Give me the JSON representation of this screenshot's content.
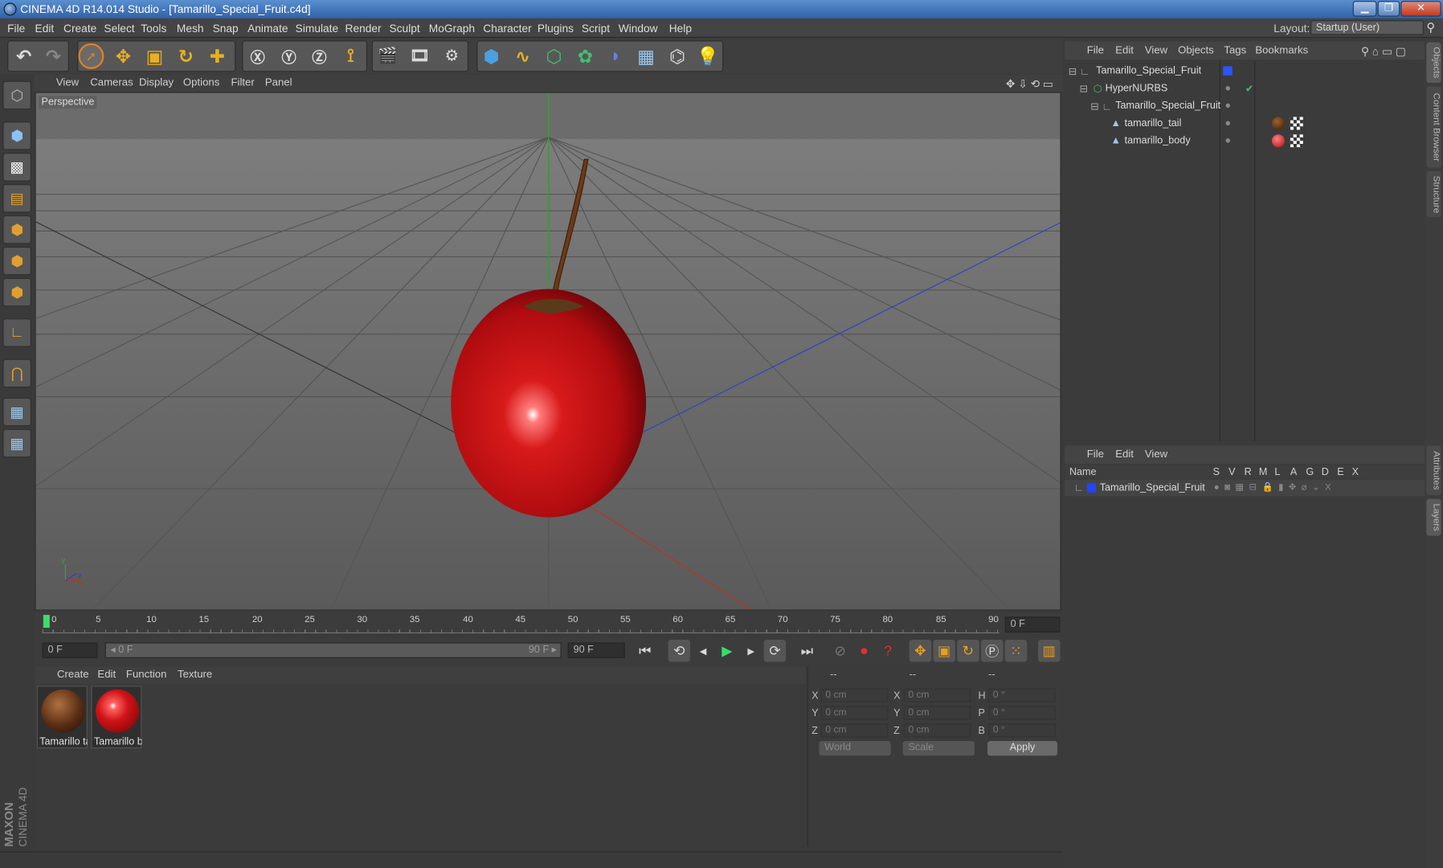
{
  "window": {
    "title": "CINEMA 4D R14.014 Studio - [Tamarillo_Special_Fruit.c4d]",
    "minimize": "▁",
    "restore": "❐",
    "close": "✕"
  },
  "menubar": [
    "File",
    "Edit",
    "Create",
    "Select",
    "Tools",
    "Mesh",
    "Snap",
    "Animate",
    "Simulate",
    "Render",
    "Sculpt",
    "MoGraph",
    "Character",
    "Plugins",
    "Script",
    "Window",
    "Help"
  ],
  "layout": {
    "label": "Layout:",
    "value": "Startup (User)"
  },
  "viewport": {
    "menu": [
      "View",
      "Cameras",
      "Display",
      "Options",
      "Filter",
      "Panel"
    ],
    "label": "Perspective"
  },
  "timeline": {
    "ticks": [
      "0",
      "5",
      "10",
      "15",
      "20",
      "25",
      "30",
      "35",
      "40",
      "45",
      "50",
      "55",
      "60",
      "65",
      "70",
      "75",
      "80",
      "85",
      "90"
    ],
    "current_frame": "0 F",
    "start_field": "0 F",
    "range_start": "◂ 0 F",
    "range_end": "90 F ▸",
    "end_field": "90 F"
  },
  "materials": {
    "menu": [
      "Create",
      "Edit",
      "Function",
      "Texture"
    ],
    "items": [
      {
        "name": "Tamarillo_tail",
        "label": "Tamarillo ta",
        "color": "#5a2e14"
      },
      {
        "name": "Tamarillo_body",
        "label": "Tamarillo b",
        "color": "#c4121a"
      }
    ]
  },
  "coordinates": {
    "header": [
      "--",
      "--",
      "--"
    ],
    "rows": [
      {
        "a": "X",
        "av": "0 cm",
        "b": "X",
        "bv": "0 cm",
        "c": "H",
        "cv": "0 °"
      },
      {
        "a": "Y",
        "av": "0 cm",
        "b": "Y",
        "bv": "0 cm",
        "c": "P",
        "cv": "0 °"
      },
      {
        "a": "Z",
        "av": "0 cm",
        "b": "Z",
        "bv": "0 cm",
        "c": "B",
        "cv": "0 °"
      }
    ],
    "mode": "World",
    "scale": "Scale",
    "apply": "Apply"
  },
  "objects": {
    "menu": [
      "File",
      "Edit",
      "View",
      "Objects",
      "Tags",
      "Bookmarks"
    ],
    "tree": [
      {
        "name": "Tamarillo_Special_Fruit"
      },
      {
        "name": "HyperNURBS"
      },
      {
        "name": "Tamarillo_Special_Fruit"
      },
      {
        "name": "tamarillo_tail"
      },
      {
        "name": "tamarillo_body"
      }
    ]
  },
  "layers": {
    "menu": [
      "File",
      "Edit",
      "View"
    ],
    "columns": [
      "Name",
      "S",
      "V",
      "R",
      "M",
      "L",
      "A",
      "G",
      "D",
      "E",
      "X"
    ],
    "rows": [
      {
        "name": "Tamarillo_Special_Fruit",
        "color": "#2244ff"
      }
    ]
  },
  "side_tabs": [
    "Objects",
    "Content Browser",
    "Structure",
    "Attributes",
    "Layers"
  ],
  "brand": {
    "maxon": "MAXON",
    "product": "CINEMA 4D"
  },
  "colors": {
    "accent": "#5a8fcf",
    "fruit": "#c4121a",
    "axis_y": "#3aa03a",
    "axis_x": "#c03020",
    "axis_z": "#3040c0"
  }
}
